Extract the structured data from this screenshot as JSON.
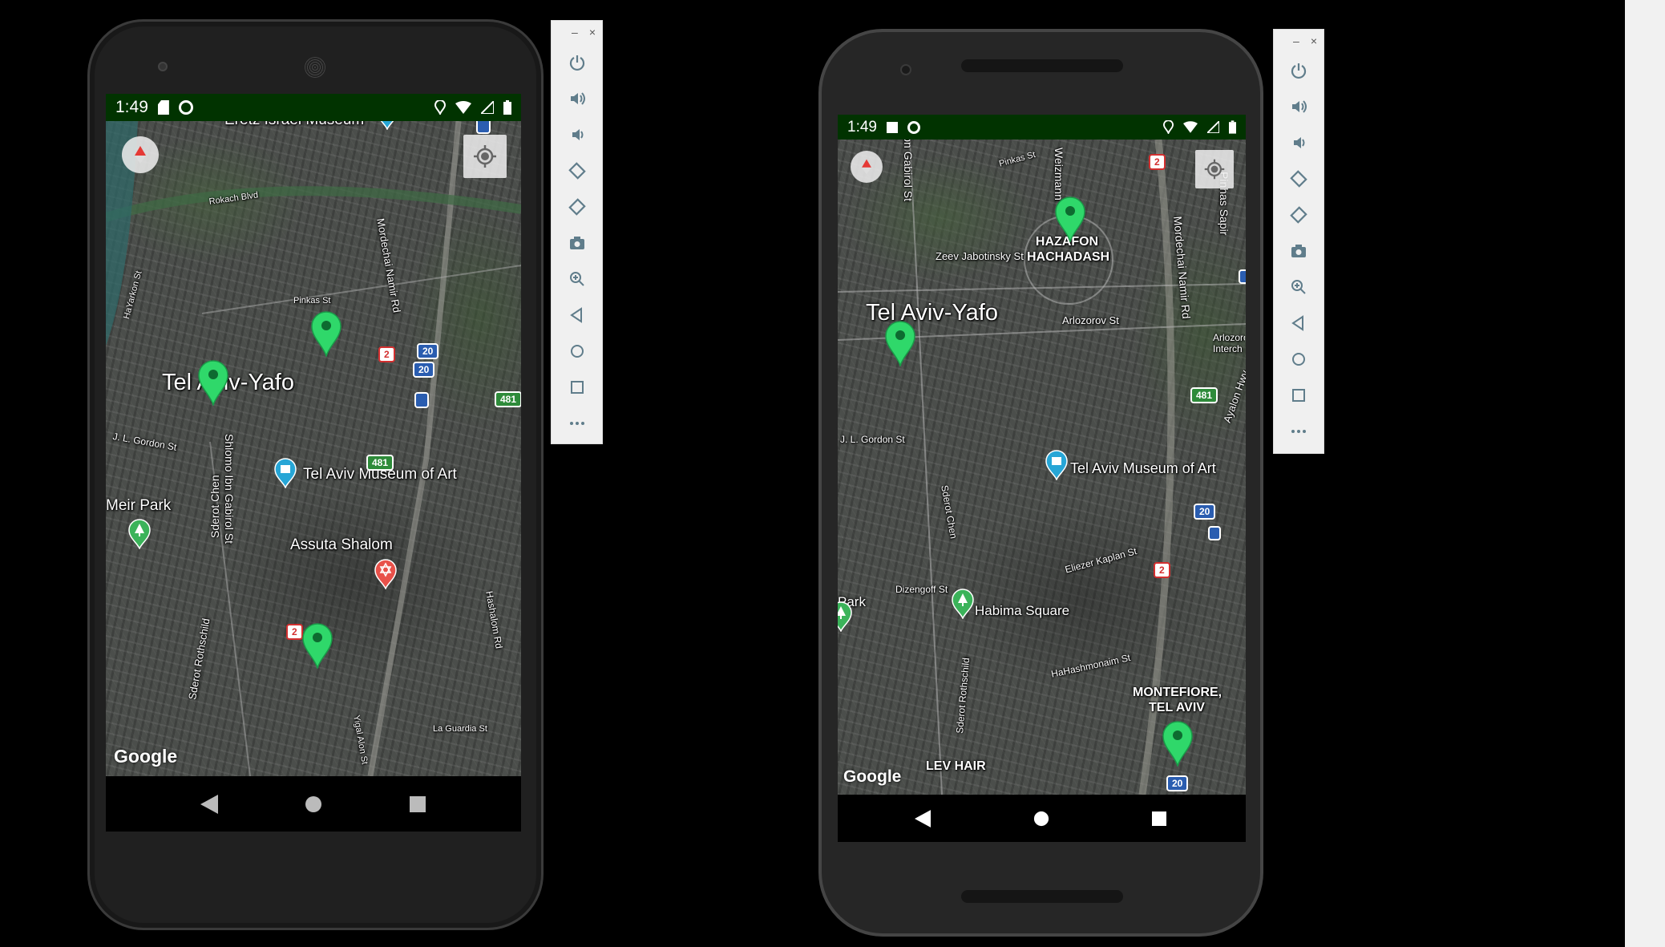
{
  "emulators": [
    {
      "status": {
        "time": "1:49"
      },
      "map": {
        "labels": {
          "eretz": "Eretz Israel Museum",
          "rokach": "Rokach Blvd",
          "hayarkon": "HaYarkon St",
          "namir": "Mordechai Namir Rd",
          "pinkas": "Pinkas St",
          "city": "Tel Aviv-Yafo",
          "gordon": "J. L. Gordon St",
          "gabirol": "Shlomo Ibn Gabirol St",
          "chen": "Sderot Chen",
          "museum": "Tel Aviv Museum of Art",
          "meirpark": "Meir Park",
          "assuta": "Assuta Shalom",
          "rothschild": "Sderot Rothschild",
          "hashalom": "Hashalom Rd",
          "laguardia": "La Guardia St",
          "yigal": "Yigal Alon St"
        },
        "shields": [
          "2",
          "20",
          "20",
          "481",
          "481",
          "2"
        ],
        "google": "Google"
      }
    },
    {
      "status": {
        "time": "1:49"
      },
      "map": {
        "labels": {
          "pinkas": "Pinkas St",
          "gabirol": "Shlomo Ibn Gabirol St",
          "weizmann": "Weizmann",
          "namir": "Mordechai Namir Rd",
          "sapir": "Pinhas Sapir",
          "hazafon": "HAZAFON HACHADASH",
          "jabotinsky": "Zeev Jabotinsky St",
          "city": "Tel Aviv-Yafo",
          "arlozorov": "Arlozorov St",
          "interchange": "Arlozorov Interch",
          "ayalon": "Ayalon Hwy",
          "gordon": "J. L. Gordon St",
          "chen": "Sderot Chen",
          "museum": "Tel Aviv Museum of Art",
          "kaplan": "Eliezer Kaplan St",
          "dizengoff": "Dizengoff St",
          "park": "Park",
          "habima": "Habima Square",
          "hashmonaim": "HaHashmonaim St",
          "rothschild": "Sderot Rothschild",
          "montefiore": "MONTEFIORE, TEL AVIV",
          "levhair": "LEV HAIR"
        },
        "shields": [
          "2",
          "481",
          "20",
          "2",
          "20"
        ],
        "google": "Google"
      }
    }
  ],
  "toolbar": {
    "minimize": "–",
    "close": "×",
    "items": [
      "power",
      "volume-up",
      "volume-down",
      "rotate-left",
      "rotate-right",
      "screenshot",
      "zoom",
      "back",
      "home",
      "overview",
      "more"
    ]
  },
  "colors": {
    "status_bar": "#013300",
    "marker": "#2fd86a",
    "toolbar": "#f0f0f0"
  }
}
